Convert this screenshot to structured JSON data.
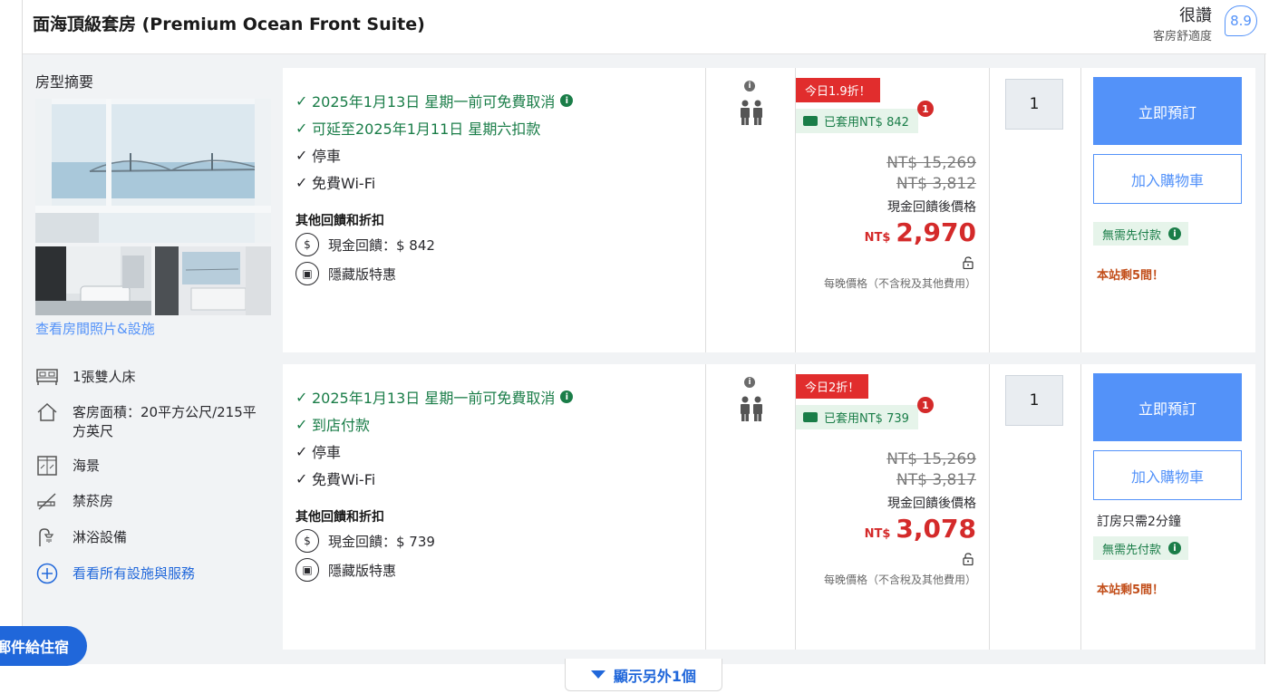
{
  "header": {
    "room_title": "面海頂級套房 (Premium Ocean Front Suite)",
    "rating_word": "很讚",
    "rating_sub": "客房舒適度",
    "rating_score": "8.9"
  },
  "summary": {
    "title": "房型摘要",
    "photo_link": "查看房間照片&設施",
    "facilities": [
      {
        "icon": "bed-icon",
        "label": "1張雙人床"
      },
      {
        "icon": "house-icon",
        "label": "客房面積：20平方公尺/215平方英尺"
      },
      {
        "icon": "window-icon",
        "label": "海景"
      },
      {
        "icon": "no-smoking-icon",
        "label": "禁菸房"
      },
      {
        "icon": "shower-icon",
        "label": "淋浴設備"
      }
    ],
    "all_facilities_link": "看看所有設施與服務"
  },
  "offers": [
    {
      "benefits": [
        {
          "text": "2025年1月13日 星期一前可免費取消",
          "green": true,
          "info": true
        },
        {
          "text": "可延至2025年1月11日 星期六扣款",
          "green": true,
          "info": false
        },
        {
          "text": "停車",
          "green": false,
          "info": false
        },
        {
          "text": "免費Wi-Fi",
          "green": false,
          "info": false
        }
      ],
      "other_title": "其他回饋和折扣",
      "cashback": "現金回饋：$ 842",
      "hidden_deal": "隱藏版特惠",
      "deal_tag": "今日1.9折！",
      "coupon": "已套用NT$ 842",
      "coupon_badge": "1",
      "original_price": "NT$ 15,269",
      "crossed_price": "NT$ 3,812",
      "price_label": "現金回饋後價格",
      "currency": "NT$",
      "price": "2,970",
      "nightly_note": "每晚價格（不含稅及其他費用）",
      "quantity": "1",
      "book_label": "立即預訂",
      "cart_label": "加入購物車",
      "booking_time": "",
      "no_prepay": "無需先付款",
      "rooms_left": "本站剩5間！"
    },
    {
      "benefits": [
        {
          "text": "2025年1月13日 星期一前可免費取消",
          "green": true,
          "info": true
        },
        {
          "text": "到店付款",
          "green": true,
          "info": false
        },
        {
          "text": "停車",
          "green": false,
          "info": false
        },
        {
          "text": "免費Wi-Fi",
          "green": false,
          "info": false
        }
      ],
      "other_title": "其他回饋和折扣",
      "cashback": "現金回饋：$ 739",
      "hidden_deal": "隱藏版特惠",
      "deal_tag": "今日2折！",
      "coupon": "已套用NT$ 739",
      "coupon_badge": "1",
      "original_price": "NT$ 15,269",
      "crossed_price": "NT$ 3,817",
      "price_label": "現金回饋後價格",
      "currency": "NT$",
      "price": "3,078",
      "nightly_note": "每晚價格（不含稅及其他費用）",
      "quantity": "1",
      "book_label": "立即預訂",
      "cart_label": "加入購物車",
      "booking_time": "訂房只需2分鐘",
      "no_prepay": "無需先付款",
      "rooms_left": "本站剩5間！"
    }
  ],
  "float_button": "郵件給住宿",
  "show_more": "顯示另外1個",
  "colors": {
    "accent": "#5392f9",
    "link": "#2067da",
    "price_red": "#d42a2a",
    "green": "#1a7d48",
    "urgency": "#c24e1a"
  }
}
